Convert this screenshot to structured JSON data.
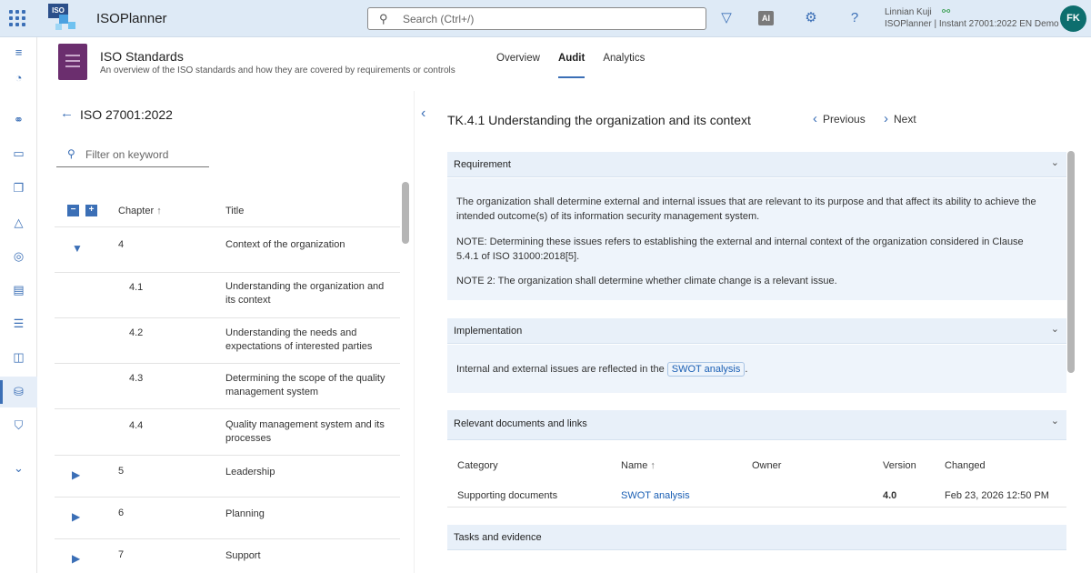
{
  "topbar": {
    "logo_text": "ISO",
    "app_name": "ISOPlanner",
    "search_placeholder": "Search (Ctrl+/)",
    "ai_label": "AI",
    "help_label": "?",
    "user_name": "Linnian Kuji",
    "user_org": "ISOPlanner | Instant 27001:2022 EN Demo",
    "avatar_initials": "FK"
  },
  "page": {
    "title": "ISO Standards",
    "subtitle": "An overview of the ISO standards and how they are covered by requirements or controls",
    "tabs": [
      {
        "label": "Overview"
      },
      {
        "label": "Audit"
      },
      {
        "label": "Analytics"
      }
    ],
    "active_tab": "Audit"
  },
  "left": {
    "standard": "ISO 27001:2022",
    "filter_placeholder": "Filter on keyword",
    "col_chapter": "Chapter",
    "col_sort": "↑",
    "col_title": "Title",
    "rows": [
      {
        "chapter": "4",
        "title": "Context of the organization"
      },
      {
        "chapter": "4.1",
        "title": "Understanding the organization and its context"
      },
      {
        "chapter": "4.2",
        "title": "Understanding the needs and expectations of interested parties"
      },
      {
        "chapter": "4.3",
        "title": "Determining the scope of the quality management system"
      },
      {
        "chapter": "4.4",
        "title": "Quality management system and its processes"
      },
      {
        "chapter": "5",
        "title": "Leadership"
      },
      {
        "chapter": "6",
        "title": "Planning"
      },
      {
        "chapter": "7",
        "title": "Support"
      }
    ]
  },
  "detail": {
    "title": "TK.4.1 Understanding the organization and its context",
    "prev_label": "Previous",
    "next_label": "Next",
    "requirement": {
      "heading": "Requirement",
      "p1": "The organization shall determine external and internal issues that are relevant to its purpose and that affect its ability to achieve the intended outcome(s) of its information security management system.",
      "p2": "NOTE: Determining these issues refers to establishing the external and internal context of the organization considered in Clause 5.4.1 of ISO 31000:2018[5].",
      "p3": "NOTE 2: The organization shall determine whether climate change is a relevant issue."
    },
    "implementation": {
      "heading": "Implementation",
      "text_before": "Internal and external issues are reflected in the",
      "link": "SWOT analysis",
      "text_after": "."
    },
    "documents": {
      "heading": "Relevant documents and links",
      "col_category": "Category",
      "col_name": "Name",
      "col_name_sort": "↑",
      "col_owner": "Owner",
      "col_version": "Version",
      "col_changed": "Changed",
      "rows": [
        {
          "category": "Supporting documents",
          "name": "SWOT analysis",
          "owner": "",
          "version": "4.0",
          "changed": "Feb 23, 2026 12:50 PM"
        }
      ]
    },
    "tasks": {
      "heading": "Tasks and evidence"
    }
  },
  "colors": {
    "accent": "#3b6fb6",
    "topbar_bg": "#deeaf6",
    "section_bg": "#e8f0f9",
    "page_icon": "#6b2e6e",
    "avatar_bg": "#0d6e6e"
  }
}
